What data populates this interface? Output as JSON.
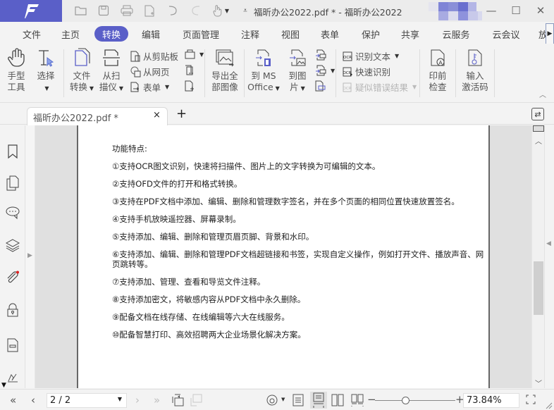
{
  "window": {
    "title": "福昕办公2022.pdf * - 福昕办公2022",
    "logo_letter": "F",
    "brand_color": "#5a5fc8",
    "quick_access": [
      "open-folder-icon",
      "save-icon",
      "print-icon",
      "new-page-icon",
      "undo-icon",
      "redo-icon",
      "hand-touch-icon",
      "customize-dropdown-icon"
    ],
    "controls": {
      "minimize": "—",
      "maximize": "☐",
      "close": "✕"
    }
  },
  "ribbon": {
    "tabs": [
      {
        "label": "文件"
      },
      {
        "label": "主页"
      },
      {
        "label": "转换",
        "active": true
      },
      {
        "label": "编辑"
      },
      {
        "label": "页面管理"
      },
      {
        "label": "注释"
      },
      {
        "label": "视图"
      },
      {
        "label": "表单"
      },
      {
        "label": "保护"
      },
      {
        "label": "共享"
      },
      {
        "label": "云服务"
      },
      {
        "label": "云会议"
      },
      {
        "label": "放"
      }
    ],
    "overflow_arrow": "▶"
  },
  "toolbar": {
    "hand": "手型\n工具",
    "hand_l1": "手型",
    "hand_l2": "工具",
    "select_l1": "选择",
    "file_convert_l1": "文件",
    "file_convert_l2": "转换",
    "scan_l1": "从扫",
    "scan_l2": "描仪",
    "from_clipboard": "从剪贴板",
    "from_web": "从网页",
    "form": "表单",
    "export_images_l1": "导出全",
    "export_images_l2": "部图像",
    "to_ms_l1": "到 MS",
    "to_ms_l2": "Office",
    "to_image_l1": "到图",
    "to_image_l2": "片",
    "ocr_text": "识别文本",
    "quick_ocr": "快速识别",
    "suspect_results": "疑似错误结果",
    "preflight_l1": "印前",
    "preflight_l2": "检查",
    "activation_l1": "输入",
    "activation_l2": "激活码"
  },
  "doc_tabs": {
    "tabs": [
      {
        "title": "福昕办公2022.pdf *"
      }
    ],
    "close": "×",
    "new": "+"
  },
  "sidebar": {
    "items": [
      "bookmark-icon",
      "pages-icon",
      "comments-icon",
      "layers-icon",
      "attachment-icon",
      "security-icon",
      "form-fields-icon",
      "signature-icon"
    ],
    "attachment_badge_color": "#e02020"
  },
  "document": {
    "heading": "功能特点:",
    "lines": [
      "①支持OCR图文识别，快速将扫描件、图片上的文字转换为可编辑的文本。",
      "②支持OFD文件的打开和格式转换。",
      "③支持在PDF文档中添加、编辑、删除和管理数字签名，并在多个页面的相同位置快速放置签名。",
      "④支持手机放映遥控器、屏幕录制。",
      "⑤支持添加、编辑、删除和管理页眉页脚、背景和水印。",
      "⑥支持添加、编辑、删除和管理PDF文档超链接和书签，实现自定义操作，例如打开文件、播放声音、网页跳转等。",
      "⑦支持添加、管理、查看和导览文件注释。",
      "⑧支持添加密文，将敏感内容从PDF文档中永久删除。",
      "⑨配备文档在线存储、在线编辑等六大在线服务。",
      "⑩配备智慧打印、高效招聘两大企业场景化解决方案。"
    ]
  },
  "statusbar": {
    "first": "«",
    "prev": "‹",
    "page": "2 / 2",
    "next": "›",
    "last": "»",
    "zoom": "73.84%",
    "zoom_fraction": 0.38,
    "zoom_minus": "−",
    "zoom_plus": "+"
  }
}
